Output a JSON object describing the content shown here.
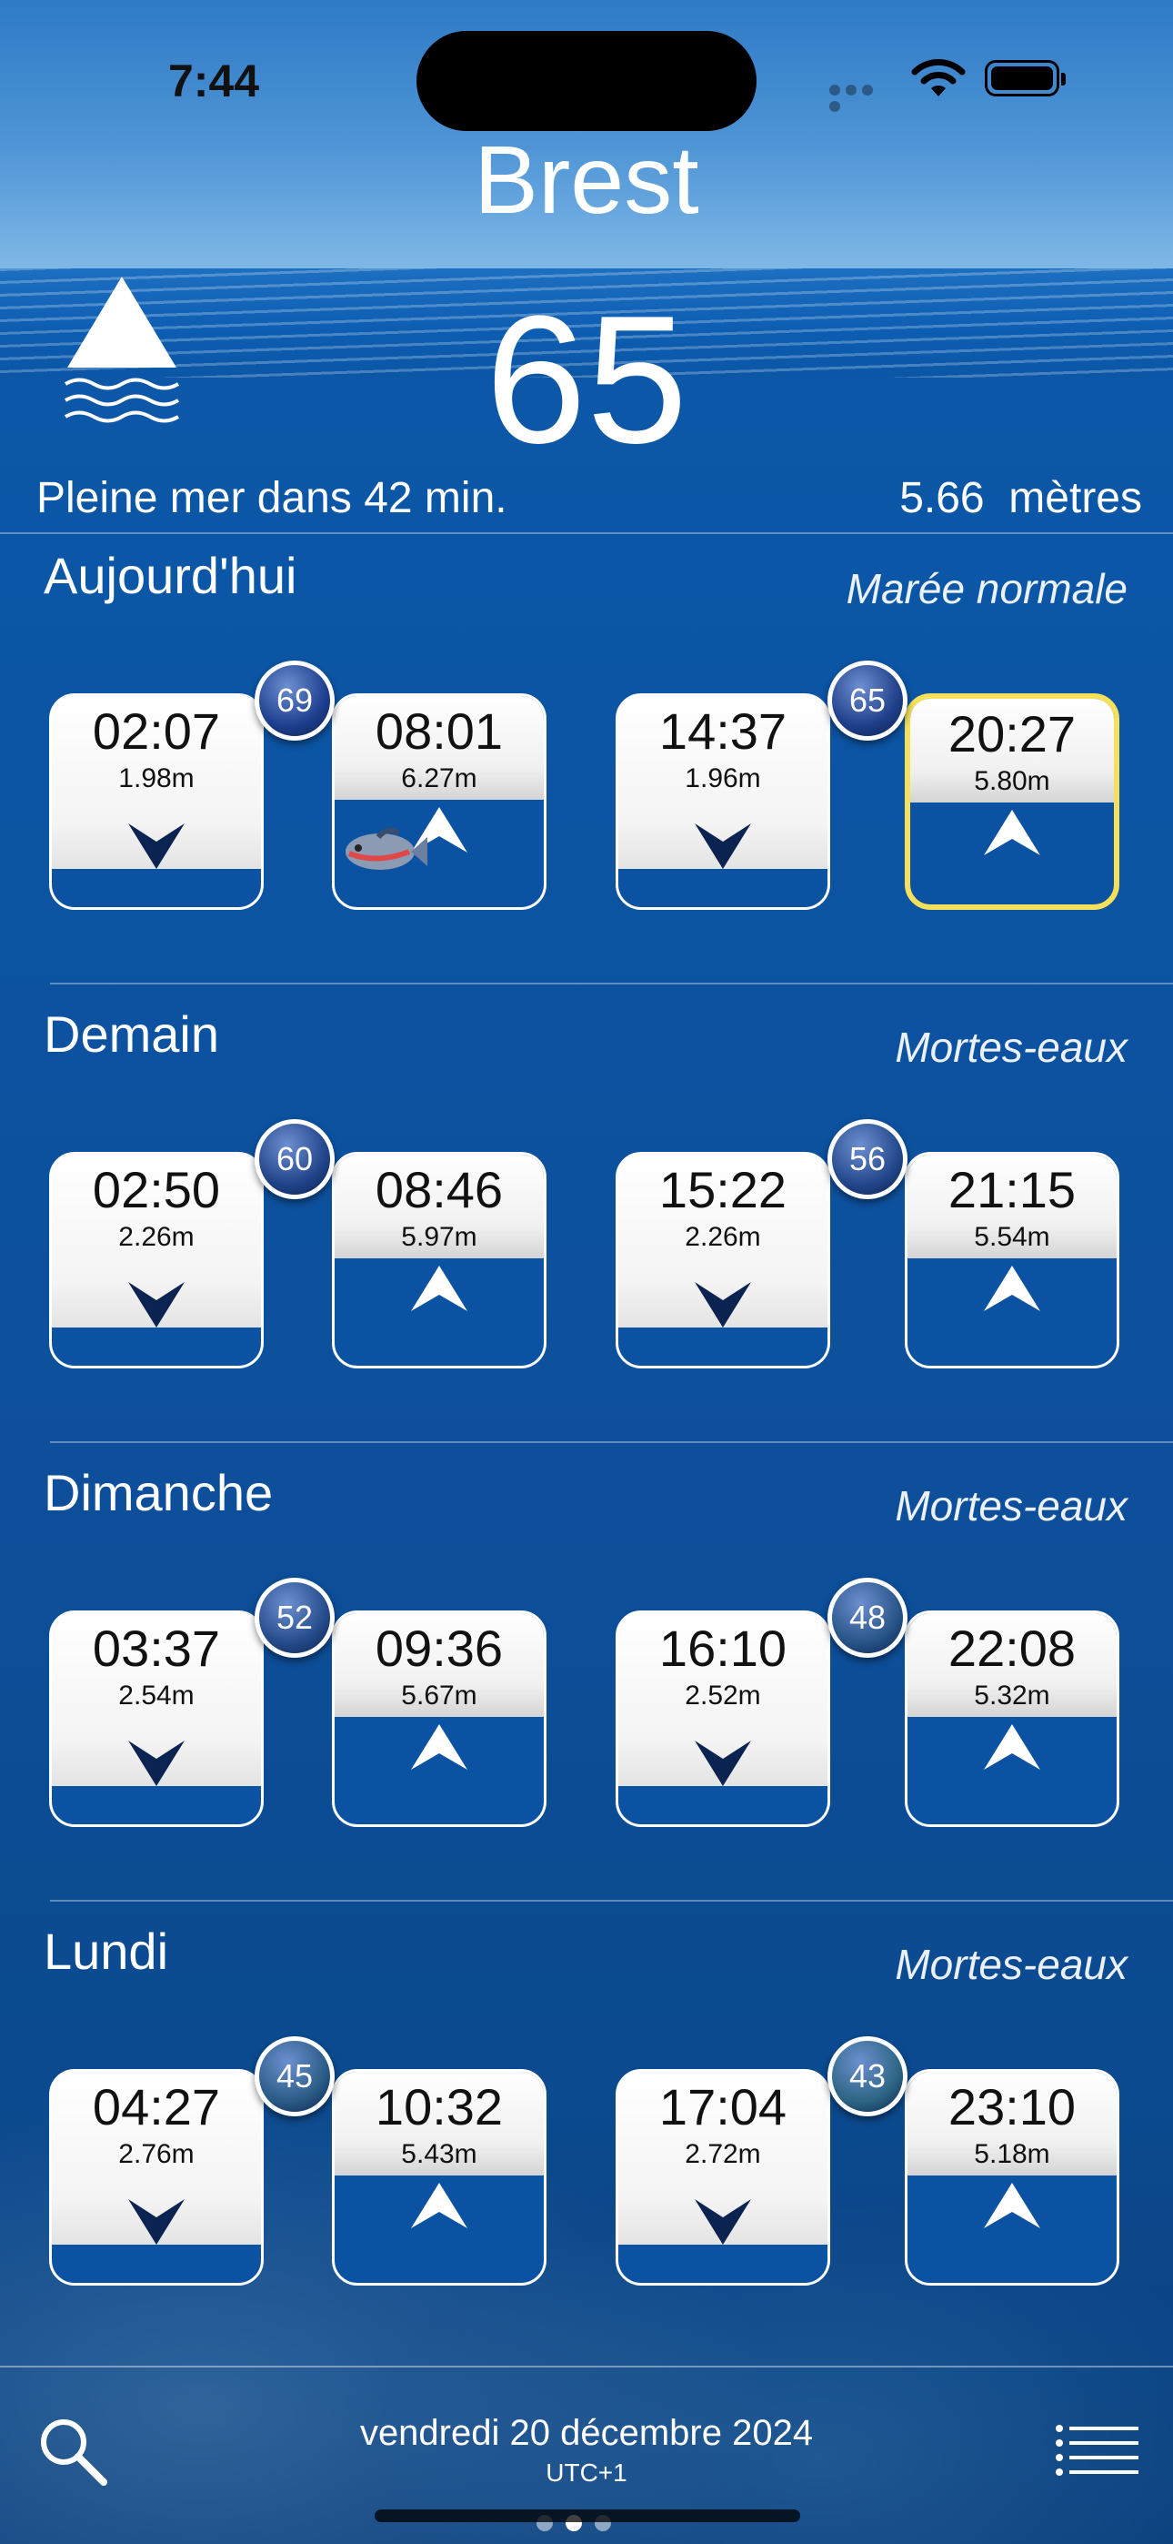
{
  "status": {
    "time": "7:44"
  },
  "header": {
    "city": "Brest",
    "current_coefficient": "65",
    "next_tide_text": "Pleine mer dans 42 min.",
    "current_height_value": "5.66",
    "current_height_unit": "mètres"
  },
  "days": [
    {
      "label": "Aujourd'hui",
      "tide_type": "Marée normale",
      "pairs": [
        {
          "coefficient": "69",
          "low": {
            "time": "02:07",
            "height": "1.98m"
          },
          "high": {
            "time": "08:01",
            "height": "6.27m"
          }
        },
        {
          "coefficient": "65",
          "low": {
            "time": "14:37",
            "height": "1.96m"
          },
          "high": {
            "time": "20:27",
            "height": "5.80m"
          }
        }
      ]
    },
    {
      "label": "Demain",
      "tide_type": "Mortes-eaux",
      "pairs": [
        {
          "coefficient": "60",
          "low": {
            "time": "02:50",
            "height": "2.26m"
          },
          "high": {
            "time": "08:46",
            "height": "5.97m"
          }
        },
        {
          "coefficient": "56",
          "low": {
            "time": "15:22",
            "height": "2.26m"
          },
          "high": {
            "time": "21:15",
            "height": "5.54m"
          }
        }
      ]
    },
    {
      "label": "Dimanche",
      "tide_type": "Mortes-eaux",
      "pairs": [
        {
          "coefficient": "52",
          "low": {
            "time": "03:37",
            "height": "2.54m"
          },
          "high": {
            "time": "09:36",
            "height": "5.67m"
          }
        },
        {
          "coefficient": "48",
          "low": {
            "time": "16:10",
            "height": "2.52m"
          },
          "high": {
            "time": "22:08",
            "height": "5.32m"
          }
        }
      ]
    },
    {
      "label": "Lundi",
      "tide_type": "Mortes-eaux",
      "pairs": [
        {
          "coefficient": "45",
          "low": {
            "time": "04:27",
            "height": "2.76m"
          },
          "high": {
            "time": "10:32",
            "height": "5.43m"
          }
        },
        {
          "coefficient": "43",
          "low": {
            "time": "17:04",
            "height": "2.72m"
          },
          "high": {
            "time": "23:10",
            "height": "5.18m"
          }
        }
      ]
    }
  ],
  "footer": {
    "date": "vendredi 20 décembre 2024",
    "utc": "UTC+1",
    "search_icon": "search-icon",
    "menu_icon": "list-menu-icon"
  },
  "colors": {
    "highlight_border": "#f5e05a",
    "sea_blue": "#0b52a3",
    "low_arrow": "#0b2350"
  }
}
